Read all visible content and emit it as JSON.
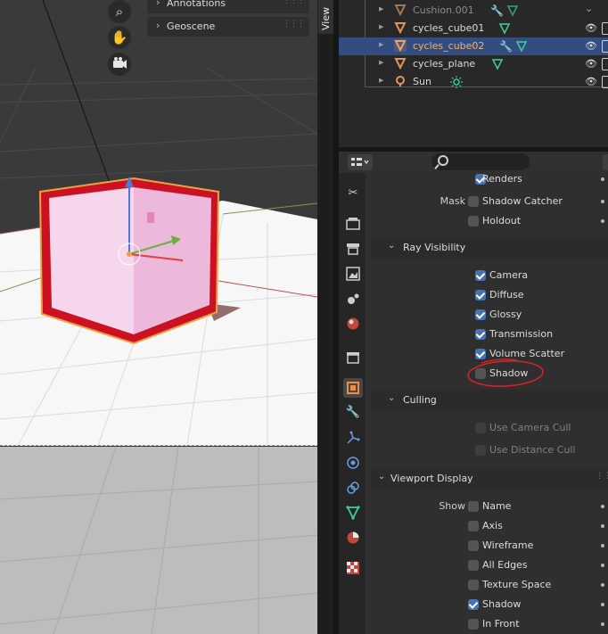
{
  "viewport": {
    "panels": [
      {
        "label": "Annotations"
      },
      {
        "label": "Geoscene"
      }
    ],
    "tab_label": "View",
    "icons": [
      "zoom-icon",
      "hand-pan-icon",
      "camera-view-icon"
    ]
  },
  "outliner": {
    "rows": [
      {
        "name": "Cushion.001",
        "type": "mesh",
        "selected": false,
        "faded": true
      },
      {
        "name": "cycles_cube01",
        "type": "mesh",
        "selected": false,
        "faded": false
      },
      {
        "name": "cycles_cube02",
        "type": "mesh",
        "selected": true,
        "faded": false
      },
      {
        "name": "cycles_plane",
        "type": "mesh",
        "selected": false,
        "faded": false
      },
      {
        "name": "Sun",
        "type": "light",
        "selected": false,
        "faded": false
      }
    ]
  },
  "properties": {
    "search_placeholder": "",
    "visibility": {
      "renders_label": "Renders",
      "mask_label": "Mask",
      "shadow_catcher_label": "Shadow Catcher",
      "holdout_label": "Holdout"
    },
    "ray_visibility": {
      "title": "Ray Visibility",
      "items": [
        {
          "label": "Camera",
          "checked": true
        },
        {
          "label": "Diffuse",
          "checked": true
        },
        {
          "label": "Glossy",
          "checked": true
        },
        {
          "label": "Transmission",
          "checked": true
        },
        {
          "label": "Volume Scatter",
          "checked": true
        },
        {
          "label": "Shadow",
          "checked": false
        }
      ]
    },
    "culling": {
      "title": "Culling",
      "use_camera_cull": "Use Camera Cull",
      "use_distance_cull": "Use Distance Cull"
    },
    "viewport_display": {
      "title": "Viewport Display",
      "show_label": "Show",
      "items": [
        {
          "label": "Name",
          "checked": false
        },
        {
          "label": "Axis",
          "checked": false
        },
        {
          "label": "Wireframe",
          "checked": false
        },
        {
          "label": "All Edges",
          "checked": false
        },
        {
          "label": "Texture Space",
          "checked": false
        },
        {
          "label": "Shadow",
          "checked": true
        },
        {
          "label": "In Front",
          "checked": false
        }
      ]
    }
  },
  "colors": {
    "selection_row": "#334d80",
    "checkbox_on": "#4772b3",
    "mesh_icon": "#e19658",
    "data_icon": "#3fd09a",
    "annotation_circle": "#e0202a"
  }
}
